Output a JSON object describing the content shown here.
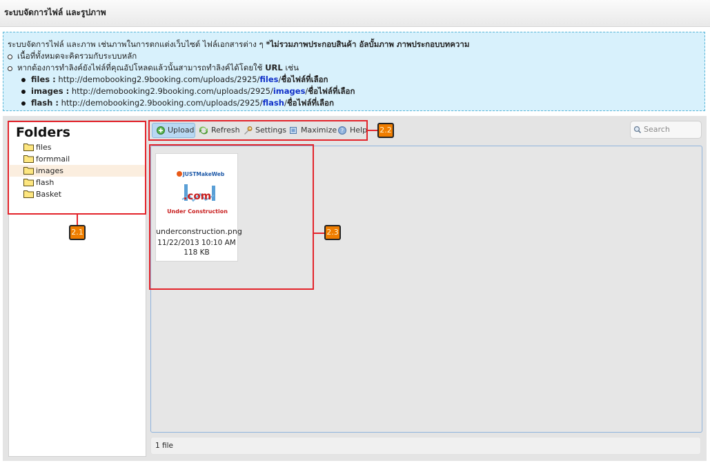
{
  "app": {
    "title": "ระบบจัดการไฟล์ และรูปภาพ"
  },
  "info": {
    "line1_normal": "ระบบจัดการไฟล์ และภาพ เช่นภาพในการตกแต่งเว็บไซต์ ไฟล์เอกสารต่าง ๆ ",
    "line1_bold": "*ไม่รวมภาพประกอบสินค้า อัลบั้มภาพ ภาพประกอบบทความ",
    "line2": "เนื้อที่ทั้งหมดจะคิดรวมกับระบบหลัก",
    "line3_normal": "หากต้องการทำลิงค์ยังไฟล์ที่คุณอัปโหลดแล้วนั้นสามารถทำลิงค์ได้โดยใช้ ",
    "line3_bold": "URL",
    "line3_tail": " เช่น",
    "links": [
      {
        "label": "files :",
        "base": " http://demobooking2.9booking.com/uploads/2925/",
        "folder": "files",
        "sep": "/",
        "tail": "ชื่อไฟล์ที่เลือก"
      },
      {
        "label": "images :",
        "base": " http://demobooking2.9booking.com/uploads/2925/",
        "folder": "images",
        "sep": "/",
        "tail": "ชื่อไฟล์ที่เลือก"
      },
      {
        "label": "flash :",
        "base": " http://demobooking2.9booking.com/uploads/2925/",
        "folder": "flash",
        "sep": "/",
        "tail": "ชื่อไฟล์ที่เลือก"
      }
    ]
  },
  "folders": {
    "header": "Folders",
    "items": [
      {
        "label": "files"
      },
      {
        "label": "formmail"
      },
      {
        "label": "images"
      },
      {
        "label": "flash"
      },
      {
        "label": "Basket"
      }
    ],
    "selected": "images"
  },
  "toolbar": {
    "upload": "Upload",
    "refresh": "Refresh",
    "settings": "Settings",
    "maximize": "Maximize",
    "help": "Help",
    "search_placeholder": "Search"
  },
  "files": [
    {
      "name": "underconstruction.png",
      "date": "11/22/2013 10:10 AM",
      "size": "118 KB",
      "thumb_text_top": "JUSTMakeWeb",
      "thumb_text_mid": ".com",
      "thumb_text_bottom": "Under Construction"
    }
  ],
  "status": {
    "count": "1 file"
  },
  "annotations": {
    "a1": "2.1",
    "a2": "2.2",
    "a3": "2.3"
  },
  "colors": {
    "accent_red": "#e3232a",
    "badge_orange": "#ef7d00",
    "info_bg": "#d8f1fc",
    "link_blue": "#1030c8"
  }
}
